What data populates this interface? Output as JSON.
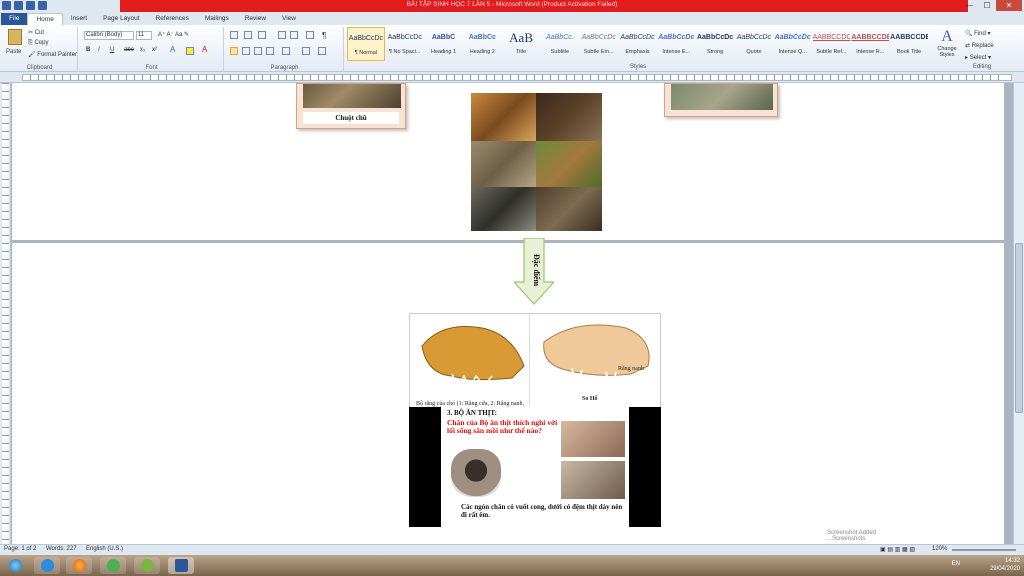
{
  "window": {
    "title": "BÀI TẬP SINH HỌC 7 LẦN 5 - Microsoft Word (Product Activation Failed)",
    "controls": [
      "—",
      "☐",
      "✕"
    ]
  },
  "ribbon_tabs": [
    "File",
    "Home",
    "Insert",
    "Page Layout",
    "References",
    "Mailings",
    "Review",
    "View"
  ],
  "clipboard": {
    "paste": "Paste",
    "cut": "Cut",
    "copy": "Copy",
    "format_painter": "Format Painter",
    "label": "Clipboard"
  },
  "font": {
    "name": "Calibri (Body)",
    "size": "11",
    "label": "Font",
    "buttons": [
      "B",
      "I",
      "U",
      "abe",
      "x₂",
      "x²"
    ]
  },
  "paragraph": {
    "label": "Paragraph"
  },
  "styles": {
    "label": "Styles",
    "items": [
      {
        "preview": "AaBbCcDc",
        "name": "¶ Normal"
      },
      {
        "preview": "AaBbCcDc",
        "name": "¶ No Spaci..."
      },
      {
        "preview": "AaBbC",
        "name": "Heading 1"
      },
      {
        "preview": "AaBbCc",
        "name": "Heading 2"
      },
      {
        "preview": "AaB",
        "name": "Title"
      },
      {
        "preview": "AaBbCc.",
        "name": "Subtitle"
      },
      {
        "preview": "AaBbCcDc",
        "name": "Subtle Em..."
      },
      {
        "preview": "AaBbCcDc",
        "name": "Emphasis"
      },
      {
        "preview": "AaBbCcDc",
        "name": "Intense E..."
      },
      {
        "preview": "AaBbCcDc",
        "name": "Strong"
      },
      {
        "preview": "AaBbCcDc",
        "name": "Quote"
      },
      {
        "preview": "AaBbCcDc",
        "name": "Intense Q..."
      },
      {
        "preview": "AABBCCDC",
        "name": "Subtle Ref..."
      },
      {
        "preview": "AABBCCDE",
        "name": "Intense R..."
      },
      {
        "preview": "AABBCCDE",
        "name": "Book Title"
      }
    ],
    "change_styles": "Change Styles"
  },
  "editing": {
    "label": "Editing",
    "find": "Find",
    "replace": "Replace",
    "select": "Select"
  },
  "document": {
    "card_left_caption": "Chuột chũ",
    "arrow_label": "Đặc điểm",
    "skull_left_caption": "Bộ răng của chó (1: Răng cửa, 2: Răng nanh, 3: Răng hàm)",
    "skull_right_caption": "So Hổ",
    "skull_right_label": "Răng nanh",
    "slide_heading": "3. BỘ ĂN THỊT:",
    "slide_question": "Chân của Bộ ăn thịt thích nghi với lối sống săn mồi như thế nào?",
    "slide_answer": "Các ngón chân có vuốt cong, dưới có đệm thịt dày nên đi rất êm."
  },
  "statusbar": {
    "page": "Page: 1 of 2",
    "words": "Words: 227",
    "language": "English (U.S.)",
    "zoom": "120%"
  },
  "popup": {
    "line1": "Screenshot Added",
    "line2": "...Screenshots"
  },
  "taskbar": {
    "time": "14:32",
    "date": "29/04/2020",
    "language": "EN"
  }
}
